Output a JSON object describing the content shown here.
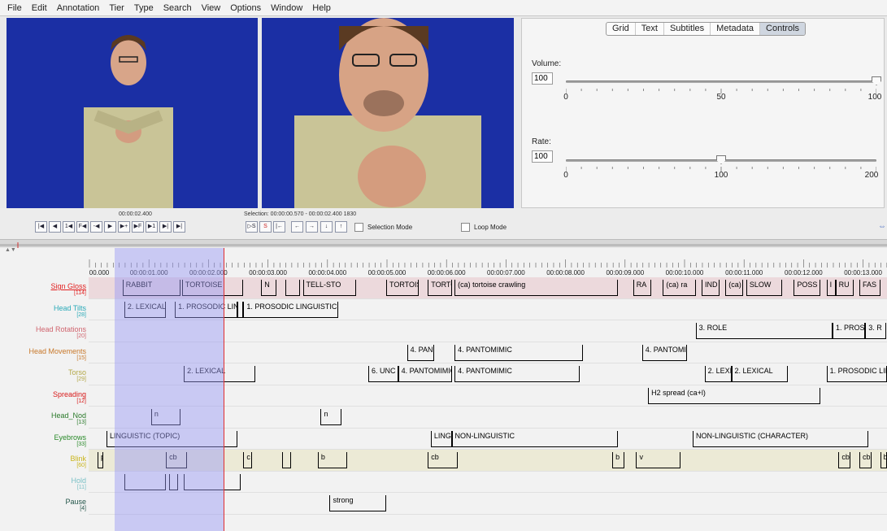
{
  "menu": [
    "File",
    "Edit",
    "Annotation",
    "Tier",
    "Type",
    "Search",
    "View",
    "Options",
    "Window",
    "Help"
  ],
  "tabs": [
    "Grid",
    "Text",
    "Subtitles",
    "Metadata",
    "Controls"
  ],
  "active_tab": "Controls",
  "volume": {
    "label": "Volume:",
    "value": "100",
    "ticks": [
      "0",
      "50",
      "100"
    ],
    "level": 1.0
  },
  "rate": {
    "label": "Rate:",
    "value": "100",
    "ticks": [
      "0",
      "100",
      "200"
    ],
    "level": 0.5
  },
  "time_display": "00:00:02.400",
  "selection_display": "Selection: 00:00:00.570 - 00:00:02.400 1830",
  "selection_mode_label": "Selection Mode",
  "loop_mode_label": "Loop Mode",
  "ruler": [
    "00.000",
    "00:00:01.000",
    "00:00:02.000",
    "00:00:03.000",
    "00:00:04.000",
    "00:00:05.000",
    "00:00:06.000",
    "00:00:07.000",
    "00:00:08.000",
    "00:00:09.000",
    "00:00:10.000",
    "00:00:11.000",
    "00:00:12.000",
    "00:00:13.000"
  ],
  "tiers": [
    {
      "name": "Sign Gloss",
      "count": "[114]",
      "color": "#e21f1f",
      "bg": "#ecd9dc",
      "anns": [
        {
          "t": "RABBIT",
          "s": 0.57,
          "e": 1.55
        },
        {
          "t": "TORTOISE",
          "s": 1.57,
          "e": 2.6
        },
        {
          "t": "N",
          "s": 2.9,
          "e": 3.15
        },
        {
          "t": "",
          "s": 3.3,
          "e": 3.55
        },
        {
          "t": "TELL-STO",
          "s": 3.6,
          "e": 4.5
        },
        {
          "t": "TORTOIS",
          "s": 5.0,
          "e": 5.55
        },
        {
          "t": "TORTO",
          "s": 5.7,
          "e": 6.1
        },
        {
          "t": "(ca) tortoise crawling",
          "s": 6.15,
          "e": 8.9
        },
        {
          "t": "RA",
          "s": 9.15,
          "e": 9.45
        },
        {
          "t": "(ca) ra",
          "s": 9.65,
          "e": 10.2
        },
        {
          "t": "IND",
          "s": 10.3,
          "e": 10.6
        },
        {
          "t": "(ca)",
          "s": 10.7,
          "e": 11.0
        },
        {
          "t": "SLOW",
          "s": 11.05,
          "e": 11.65
        },
        {
          "t": "POSS",
          "s": 11.85,
          "e": 12.3
        },
        {
          "t": "I",
          "s": 12.4,
          "e": 12.55
        },
        {
          "t": "RU",
          "s": 12.55,
          "e": 12.85
        },
        {
          "t": "FAS",
          "s": 12.95,
          "e": 13.3
        }
      ]
    },
    {
      "name": "Head Tilts",
      "count": "[28]",
      "color": "#2aaab8",
      "bg": "#f2f2f2",
      "anns": [
        {
          "t": "2. LEXICAL",
          "s": 0.6,
          "e": 1.3
        },
        {
          "t": "1. PROSODIC LIN",
          "s": 1.45,
          "e": 2.5
        },
        {
          "t": "",
          "s": 2.5,
          "e": 2.6
        },
        {
          "t": "1. PROSODIC LINGUISTIC",
          "s": 2.6,
          "e": 4.2
        }
      ]
    },
    {
      "name": "Head Rotations",
      "count": "[20]",
      "color": "#d0646e",
      "bg": "#f2f2f2",
      "anns": [
        {
          "t": "3. ROLE",
          "s": 10.2,
          "e": 12.5
        },
        {
          "t": "1. PROSODIC",
          "s": 12.5,
          "e": 13.05
        },
        {
          "t": "3. R",
          "s": 13.05,
          "e": 13.4
        }
      ]
    },
    {
      "name": "Head Movements",
      "count": "[15]",
      "color": "#c8782a",
      "bg": "#f2f2f2",
      "anns": [
        {
          "t": "4. PAN",
          "s": 5.35,
          "e": 5.8
        },
        {
          "t": "4. PANTOMIMIC",
          "s": 6.15,
          "e": 8.3
        },
        {
          "t": "4. PANTOMI",
          "s": 9.3,
          "e": 10.05
        }
      ]
    },
    {
      "name": "Torso",
      "count": "[29]",
      "color": "#b4a848",
      "bg": "#f2f2f2",
      "anns": [
        {
          "t": "2. LEXICAL",
          "s": 1.6,
          "e": 2.8
        },
        {
          "t": "6. UNC",
          "s": 4.7,
          "e": 5.2
        },
        {
          "t": "4. PANTOMIMIC",
          "s": 5.2,
          "e": 6.1
        },
        {
          "t": "4. PANTOMIMIC",
          "s": 6.15,
          "e": 8.25
        },
        {
          "t": "2. LEXICA",
          "s": 10.35,
          "e": 10.8
        },
        {
          "t": "2. LEXICAL",
          "s": 10.8,
          "e": 11.75
        },
        {
          "t": "1. PROSODIC LING",
          "s": 12.4,
          "e": 13.5
        }
      ]
    },
    {
      "name": "Spreading",
      "count": "[12]",
      "color": "#d81a1a",
      "bg": "#f2f2f2",
      "anns": [
        {
          "t": "H2 spread (ca+l)",
          "s": 9.4,
          "e": 12.3
        }
      ]
    },
    {
      "name": "Head_Nod",
      "count": "[13]",
      "color": "#2a7a2a",
      "bg": "#f2f2f2",
      "anns": [
        {
          "t": "n",
          "s": 1.05,
          "e": 1.55
        },
        {
          "t": "n",
          "s": 3.9,
          "e": 4.25
        }
      ]
    },
    {
      "name": "Eyebrows",
      "count": "[33]",
      "color": "#2a8a2a",
      "bg": "#f2f2f2",
      "anns": [
        {
          "t": "LINGUISTIC (TOPIC)",
          "s": 0.3,
          "e": 2.5
        },
        {
          "t": "LINGUISTI",
          "s": 5.75,
          "e": 6.1
        },
        {
          "t": "NON-LINGUISTIC",
          "s": 6.1,
          "e": 8.9
        },
        {
          "t": "NON-LINGUISTIC (CHARACTER)",
          "s": 10.15,
          "e": 13.1
        }
      ]
    },
    {
      "name": "Blink",
      "count": "[60]",
      "color": "#c9b41a",
      "bg": "#ecead6",
      "anns": [
        {
          "t": "p",
          "s": 0.15,
          "e": 0.25
        },
        {
          "t": "cb",
          "s": 1.3,
          "e": 1.65
        },
        {
          "t": "c",
          "s": 2.6,
          "e": 2.75
        },
        {
          "t": "",
          "s": 3.25,
          "e": 3.4
        },
        {
          "t": "b",
          "s": 3.85,
          "e": 4.35
        },
        {
          "t": "cb",
          "s": 5.7,
          "e": 6.2
        },
        {
          "t": "b",
          "s": 8.8,
          "e": 9.0
        },
        {
          "t": "v",
          "s": 9.2,
          "e": 9.95
        },
        {
          "t": "cb",
          "s": 12.6,
          "e": 12.8
        },
        {
          "t": "cb",
          "s": 12.95,
          "e": 13.15
        },
        {
          "t": "b",
          "s": 13.3,
          "e": 13.45
        }
      ]
    },
    {
      "name": "Hold",
      "count": "[11]",
      "color": "#7ac0c6",
      "bg": "#f2f2f2",
      "anns": [
        {
          "t": "",
          "s": 0.6,
          "e": 1.3
        },
        {
          "t": "",
          "s": 1.35,
          "e": 1.5
        },
        {
          "t": "",
          "s": 1.6,
          "e": 2.55
        }
      ]
    },
    {
      "name": "Pause",
      "count": "[4]",
      "color": "#24564a",
      "bg": "#f2f2f2",
      "anns": [
        {
          "t": "strong",
          "s": 4.05,
          "e": 5.0
        }
      ]
    }
  ]
}
